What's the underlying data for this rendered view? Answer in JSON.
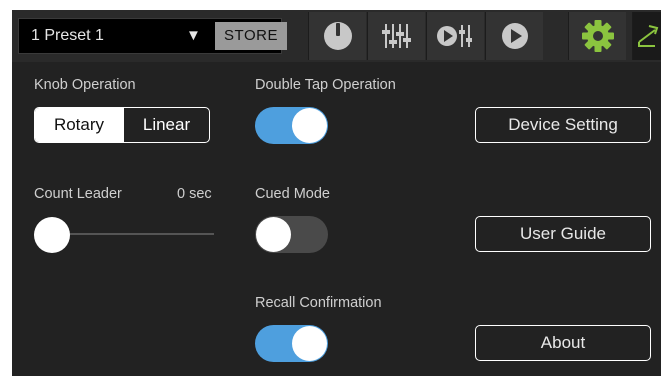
{
  "topbar": {
    "preset_label": "1  Preset 1",
    "preset_dropdown_arrow": "▼",
    "store_label": "STORE",
    "buttons": [
      {
        "name": "knob-view-icon"
      },
      {
        "name": "mixer-view-icon"
      },
      {
        "name": "play-mixer-view-icon"
      },
      {
        "name": "play-view-icon"
      },
      {
        "name": "gear-icon"
      },
      {
        "name": "switch-icon"
      }
    ],
    "accent_color": "#8bc43f"
  },
  "settings": {
    "knob_operation": {
      "label": "Knob Operation",
      "options": [
        "Rotary",
        "Linear"
      ],
      "selected": "Rotary"
    },
    "count_leader": {
      "label": "Count Leader",
      "value": "0 sec",
      "level": 0
    },
    "double_tap": {
      "label": "Double Tap Operation",
      "on": true
    },
    "cued_mode": {
      "label": "Cued Mode",
      "on": false
    },
    "recall_confirmation": {
      "label": "Recall Confirmation",
      "on": true
    },
    "toggle_on_color": "#4e9fde"
  },
  "actions": {
    "device_setting": "Device Setting",
    "user_guide": "User Guide",
    "about": "About"
  }
}
